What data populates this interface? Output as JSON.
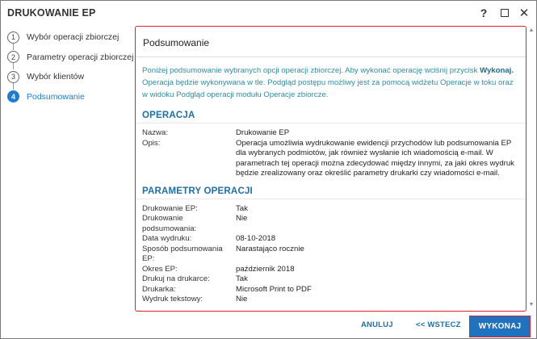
{
  "window": {
    "title": "DRUKOWANIE EP",
    "help_label": "?",
    "close_label": "✕"
  },
  "steps": [
    {
      "num": "1",
      "label": "Wybór operacji zbiorczej",
      "active": false
    },
    {
      "num": "2",
      "label": "Parametry operacji zbiorczej",
      "active": false
    },
    {
      "num": "3",
      "label": "Wybór klientów",
      "active": false
    },
    {
      "num": "4",
      "label": "Podsumowanie",
      "active": true
    }
  ],
  "panel": {
    "heading": "Podsumowanie",
    "intro_part1": "Poniżej podsumowanie wybranych opcji operacji zbiorczej. Aby wykonać operację wciśnij przycisk ",
    "intro_bold": "Wykonaj.",
    "intro_part2": " Operacja będzie wykonywana w tle. Podgląd postępu możliwy jest za pomocą widżetu Operacje w toku oraz w widoku Podgląd operacji modułu Operacje zbiorcze.",
    "operacja": {
      "title": "OPERACJA",
      "rows": [
        {
          "key": "Nazwa:",
          "value": "Drukowanie EP"
        },
        {
          "key": "Opis:",
          "value": "Operacja umożliwia wydrukowanie ewidencji przychodów lub podsumowania EP dla wybranych podmiotów, jak również wysłanie ich wiadomością e-mail. W parametrach tej operacji można zdecydować między innymi, za jaki okres wydruk będzie zrealizowany oraz określić parametry drukarki czy wiadomości e-mail."
        }
      ]
    },
    "parametry": {
      "title": "PARAMETRY OPERACJI",
      "rows": [
        {
          "key": "Drukowanie EP:",
          "value": "Tak"
        },
        {
          "key": "Drukowanie podsumowania:",
          "value": "Nie"
        },
        {
          "key": "Data wydruku:",
          "value": "08-10-2018"
        },
        {
          "key": "Sposób podsumowania EP:",
          "value": "Narastająco rocznie"
        },
        {
          "key": "Okres EP:",
          "value": "październik 2018"
        },
        {
          "key": "Drukuj na drukarce:",
          "value": "Tak"
        },
        {
          "key": "Drukarka:",
          "value": "Microsoft Print to PDF"
        },
        {
          "key": "Wydruk tekstowy:",
          "value": "Nie"
        }
      ]
    }
  },
  "footer": {
    "cancel_label": "ANULUJ",
    "back_label": "<< WSTECZ",
    "execute_label": "WYKONAJ"
  },
  "colors": {
    "accent": "#1e72c0",
    "highlight_border": "#e02030",
    "intro_text": "#2a8fa0"
  }
}
